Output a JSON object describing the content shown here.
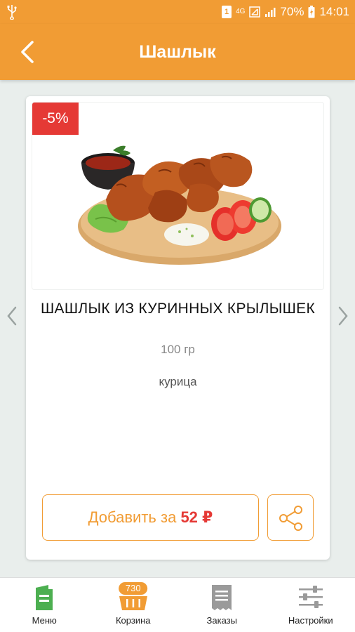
{
  "status_bar": {
    "sim_label": "1",
    "network": "4G",
    "battery": "70%",
    "time": "14:01"
  },
  "toolbar": {
    "title": "Шашлык"
  },
  "product": {
    "discount": "-5%",
    "name": "ШАШЛЫК ИЗ КУРИННЫХ КРЫЛЫШЕК",
    "weight": "100 гр",
    "description": "курица",
    "add_label": "Добавить за ",
    "price": "52 ₽"
  },
  "bottom_nav": {
    "items": [
      {
        "label": "Меню",
        "icon": "menu-icon"
      },
      {
        "label": "Корзина",
        "icon": "basket-icon",
        "badge": "730"
      },
      {
        "label": "Заказы",
        "icon": "receipt-icon"
      },
      {
        "label": "Настройки",
        "icon": "settings-sliders-icon"
      }
    ]
  },
  "colors": {
    "accent": "#f19c34",
    "discount": "#e53935",
    "menu_icon": "#4caf50"
  }
}
